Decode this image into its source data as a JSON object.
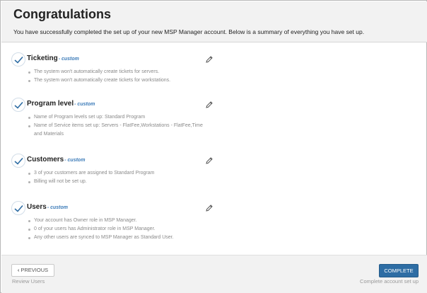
{
  "header": {
    "title": "Congratulations",
    "subtitle": "You have successfully completed the set up of your new MSP Manager account. Below is a summary of everything you have set up."
  },
  "sections": [
    {
      "title": "Ticketing",
      "tag": "- custom",
      "bullets": [
        "The system won't automatically create tickets for servers.",
        "The system won't automatically create tickets for workstations."
      ]
    },
    {
      "title": "Program level",
      "tag": "- custom",
      "bullets": [
        "Name of Program levels set up: Standard Program",
        "Name of Service items set up: Servers - FlatFee,Workstations - FlatFee,Time and Materials"
      ]
    },
    {
      "title": "Customers",
      "tag": "- custom",
      "bullets": [
        "3 of your customers are assigned to Standard Program",
        "Billing will not be set up."
      ]
    },
    {
      "title": "Users",
      "tag": "- custom",
      "bullets": [
        "Your account has Owner role in MSP Manager.",
        "0 of your users has Administrator role in MSP Manager.",
        "Any other users are synced to MSP Manager as Standard User."
      ]
    }
  ],
  "footer": {
    "previous_label": "PREVIOUS",
    "previous_sub": "Review Users",
    "complete_label": "COMPLETE",
    "complete_sub": "Complete account set up"
  },
  "icons": {
    "check": "check-icon",
    "edit": "pencil-icon",
    "previous": "chevron-left-icon"
  },
  "colors": {
    "accent": "#2e6da4",
    "custom_tag": "#3a7ab8",
    "check": "#2e6da4"
  }
}
